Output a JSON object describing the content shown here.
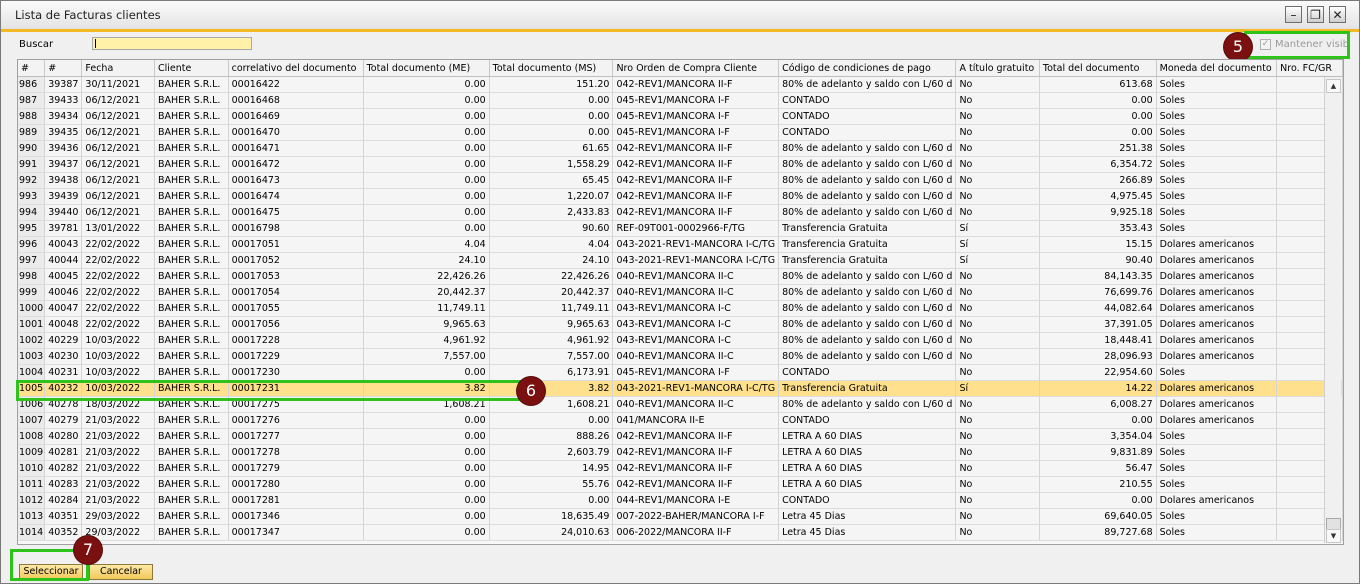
{
  "window": {
    "title": "Lista de Facturas clientes"
  },
  "search": {
    "label": "Buscar",
    "value": ""
  },
  "keep_visible": {
    "label": "Mantener visib",
    "checked": true
  },
  "badges": {
    "b5": "5",
    "b6": "6",
    "b7": "7"
  },
  "table": {
    "headers": [
      "#",
      "#",
      "Fecha",
      "Cliente",
      "correlativo del documento",
      "Total documento (ME)",
      "Total documento (MS)",
      "Nro Orden de Compra Cliente",
      "Código de condiciones de pago",
      "A título gratuito",
      "Total del documento",
      "Moneda del documento",
      "Nro. FC/GR"
    ],
    "rows": [
      [
        "986",
        "39387",
        "30/11/2021",
        "BAHER S.R.L.",
        "00016422",
        "0.00",
        "151.20",
        "042-REV1/MANCORA II-F",
        "80% de adelanto y saldo con L/60 d",
        "No",
        "613.68",
        "Soles",
        ""
      ],
      [
        "987",
        "39433",
        "06/12/2021",
        "BAHER S.R.L.",
        "00016468",
        "0.00",
        "0.00",
        "045-REV1/MANCORA I-F",
        "CONTADO",
        "No",
        "0.00",
        "Soles",
        ""
      ],
      [
        "988",
        "39434",
        "06/12/2021",
        "BAHER S.R.L.",
        "00016469",
        "0.00",
        "0.00",
        "045-REV1/MANCORA I-F",
        "CONTADO",
        "No",
        "0.00",
        "Soles",
        ""
      ],
      [
        "989",
        "39435",
        "06/12/2021",
        "BAHER S.R.L.",
        "00016470",
        "0.00",
        "0.00",
        "045-REV1/MANCORA I-F",
        "CONTADO",
        "No",
        "0.00",
        "Soles",
        ""
      ],
      [
        "990",
        "39436",
        "06/12/2021",
        "BAHER S.R.L.",
        "00016471",
        "0.00",
        "61.65",
        "042-REV1/MANCORA II-F",
        "80% de adelanto y saldo con L/60 d",
        "No",
        "251.38",
        "Soles",
        ""
      ],
      [
        "991",
        "39437",
        "06/12/2021",
        "BAHER S.R.L.",
        "00016472",
        "0.00",
        "1,558.29",
        "042-REV1/MANCORA II-F",
        "80% de adelanto y saldo con L/60 d",
        "No",
        "6,354.72",
        "Soles",
        ""
      ],
      [
        "992",
        "39438",
        "06/12/2021",
        "BAHER S.R.L.",
        "00016473",
        "0.00",
        "65.45",
        "042-REV1/MANCORA II-F",
        "80% de adelanto y saldo con L/60 d",
        "No",
        "266.89",
        "Soles",
        ""
      ],
      [
        "993",
        "39439",
        "06/12/2021",
        "BAHER S.R.L.",
        "00016474",
        "0.00",
        "1,220.07",
        "042-REV1/MANCORA II-F",
        "80% de adelanto y saldo con L/60 d",
        "No",
        "4,975.45",
        "Soles",
        ""
      ],
      [
        "994",
        "39440",
        "06/12/2021",
        "BAHER S.R.L.",
        "00016475",
        "0.00",
        "2,433.83",
        "042-REV1/MANCORA II-F",
        "80% de adelanto y saldo con L/60 d",
        "No",
        "9,925.18",
        "Soles",
        ""
      ],
      [
        "995",
        "39781",
        "13/01/2022",
        "BAHER S.R.L.",
        "00016798",
        "0.00",
        "90.60",
        "REF-09T001-0002966-F/TG",
        "Transferencia Gratuita",
        "Sí",
        "353.43",
        "Soles",
        ""
      ],
      [
        "996",
        "40043",
        "22/02/2022",
        "BAHER S.R.L.",
        "00017051",
        "4.04",
        "4.04",
        "043-2021-REV1-MANCORA I-C/TG",
        "Transferencia Gratuita",
        "Sí",
        "15.15",
        "Dolares americanos",
        ""
      ],
      [
        "997",
        "40044",
        "22/02/2022",
        "BAHER S.R.L.",
        "00017052",
        "24.10",
        "24.10",
        "043-2021-REV1-MANCORA I-C/TG",
        "Transferencia Gratuita",
        "Sí",
        "90.40",
        "Dolares americanos",
        ""
      ],
      [
        "998",
        "40045",
        "22/02/2022",
        "BAHER S.R.L.",
        "00017053",
        "22,426.26",
        "22,426.26",
        "040-REV1/MANCORA II-C",
        "80% de adelanto y saldo con L/60 d",
        "No",
        "84,143.35",
        "Dolares americanos",
        ""
      ],
      [
        "999",
        "40046",
        "22/02/2022",
        "BAHER S.R.L.",
        "00017054",
        "20,442.37",
        "20,442.37",
        "040-REV1/MANCORA II-C",
        "80% de adelanto y saldo con L/60 d",
        "No",
        "76,699.76",
        "Dolares americanos",
        ""
      ],
      [
        "1000",
        "40047",
        "22/02/2022",
        "BAHER S.R.L.",
        "00017055",
        "11,749.11",
        "11,749.11",
        "043-REV1/MANCORA I-C",
        "80% de adelanto y saldo con L/60 d",
        "No",
        "44,082.64",
        "Dolares americanos",
        ""
      ],
      [
        "1001",
        "40048",
        "22/02/2022",
        "BAHER S.R.L.",
        "00017056",
        "9,965.63",
        "9,965.63",
        "043-REV1/MANCORA I-C",
        "80% de adelanto y saldo con L/60 d",
        "No",
        "37,391.05",
        "Dolares americanos",
        ""
      ],
      [
        "1002",
        "40229",
        "10/03/2022",
        "BAHER S.R.L.",
        "00017228",
        "4,961.92",
        "4,961.92",
        "043-REV1/MANCORA I-C",
        "80% de adelanto y saldo con L/60 d",
        "No",
        "18,448.41",
        "Dolares americanos",
        ""
      ],
      [
        "1003",
        "40230",
        "10/03/2022",
        "BAHER S.R.L.",
        "00017229",
        "7,557.00",
        "7,557.00",
        "040-REV1/MANCORA II-C",
        "80% de adelanto y saldo con L/60 d",
        "No",
        "28,096.93",
        "Dolares americanos",
        ""
      ],
      [
        "1004",
        "40231",
        "10/03/2022",
        "BAHER S.R.L.",
        "00017230",
        "0.00",
        "6,173.91",
        "045-REV1/MANCORA I-F",
        "CONTADO",
        "No",
        "22,954.60",
        "Soles",
        ""
      ],
      [
        "1005",
        "40232",
        "10/03/2022",
        "BAHER S.R.L.",
        "00017231",
        "3.82",
        "3.82",
        "043-2021-REV1-MANCORA I-C/TG",
        "Transferencia Gratuita",
        "Sí",
        "14.22",
        "Dolares americanos",
        ""
      ],
      [
        "1006",
        "40278",
        "18/03/2022",
        "BAHER S.R.L.",
        "00017275",
        "1,608.21",
        "1,608.21",
        "040-REV1/MANCORA II-C",
        "80% de adelanto y saldo con L/60 d",
        "No",
        "6,008.27",
        "Dolares americanos",
        ""
      ],
      [
        "1007",
        "40279",
        "21/03/2022",
        "BAHER S.R.L.",
        "00017276",
        "0.00",
        "0.00",
        "041/MANCORA II-E",
        "CONTADO",
        "No",
        "0.00",
        "Dolares americanos",
        ""
      ],
      [
        "1008",
        "40280",
        "21/03/2022",
        "BAHER S.R.L.",
        "00017277",
        "0.00",
        "888.26",
        "042-REV1/MANCORA II-F",
        "LETRA A 60 DIAS",
        "No",
        "3,354.04",
        "Soles",
        ""
      ],
      [
        "1009",
        "40281",
        "21/03/2022",
        "BAHER S.R.L.",
        "00017278",
        "0.00",
        "2,603.79",
        "042-REV1/MANCORA II-F",
        "LETRA A 60 DIAS",
        "No",
        "9,831.89",
        "Soles",
        ""
      ],
      [
        "1010",
        "40282",
        "21/03/2022",
        "BAHER S.R.L.",
        "00017279",
        "0.00",
        "14.95",
        "042-REV1/MANCORA II-F",
        "LETRA A 60 DIAS",
        "No",
        "56.47",
        "Soles",
        ""
      ],
      [
        "1011",
        "40283",
        "21/03/2022",
        "BAHER S.R.L.",
        "00017280",
        "0.00",
        "55.76",
        "042-REV1/MANCORA II-F",
        "LETRA A 60 DIAS",
        "No",
        "210.55",
        "Soles",
        ""
      ],
      [
        "1012",
        "40284",
        "21/03/2022",
        "BAHER S.R.L.",
        "00017281",
        "0.00",
        "0.00",
        "044-REV1/MANCORA I-E",
        "CONTADO",
        "No",
        "0.00",
        "Dolares americanos",
        ""
      ],
      [
        "1013",
        "40351",
        "29/03/2022",
        "BAHER S.R.L.",
        "00017346",
        "0.00",
        "18,635.49",
        "007-2022-BAHER/MANCORA I-F",
        "Letra 45 Dias",
        "No",
        "69,640.05",
        "Soles",
        ""
      ],
      [
        "1014",
        "40352",
        "29/03/2022",
        "BAHER S.R.L.",
        "00017347",
        "0.00",
        "24,010.63",
        "006-2022/MANCORA II-F",
        "Letra 45 Dias",
        "No",
        "89,727.68",
        "Soles",
        ""
      ]
    ]
  },
  "buttons": {
    "select": "Seleccionar",
    "cancel": "Cancelar"
  }
}
